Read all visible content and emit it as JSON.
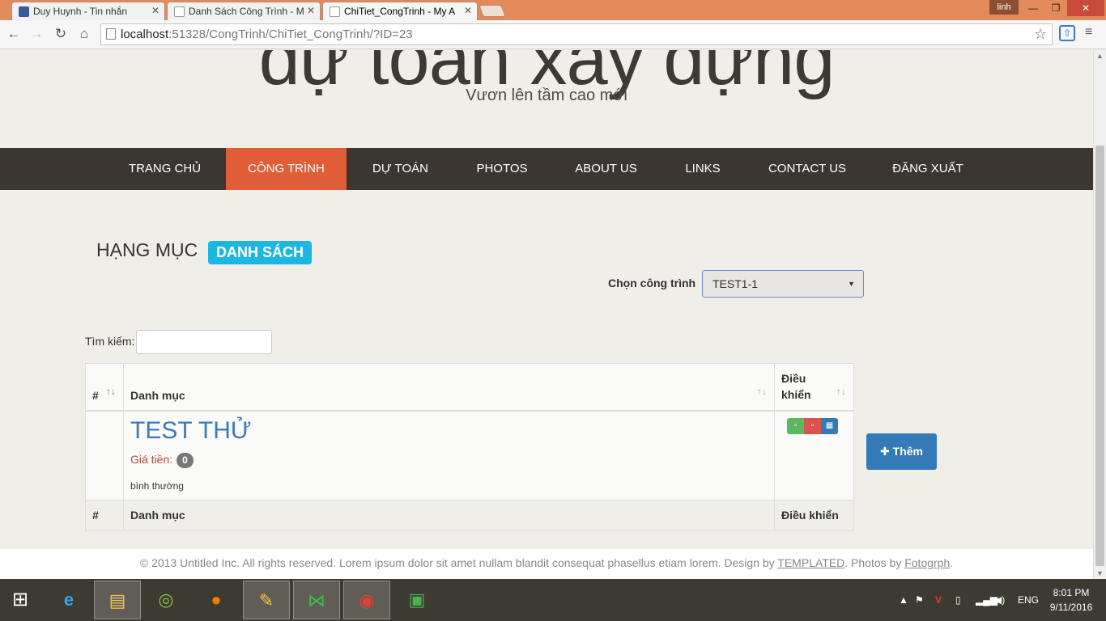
{
  "browser": {
    "tabs": [
      {
        "title": "Duy Huynh - Tin nhắn"
      },
      {
        "title": "Danh Sách Công Trình - M"
      },
      {
        "title": "ChiTiet_CongTrinh - My A"
      }
    ],
    "user": "linh",
    "url_host": "localhost",
    "url_path": ":51328/CongTrinh/ChiTiet_CongTrinh/?ID=23"
  },
  "header": {
    "site_title": "dự toán xây dựng",
    "tagline": "Vươn lên tầm cao mới"
  },
  "nav": {
    "items": [
      {
        "label": "TRANG CHỦ"
      },
      {
        "label": "CÔNG TRÌNH"
      },
      {
        "label": "DỰ TOÁN"
      },
      {
        "label": "PHOTOS"
      },
      {
        "label": "ABOUT US"
      },
      {
        "label": "LINKS"
      },
      {
        "label": "CONTACT US"
      },
      {
        "label": "ĐĂNG XUẤT"
      }
    ],
    "active": "CÔNG TRÌNH"
  },
  "main": {
    "title": "HẠNG MỤC",
    "badge": "DANH SÁCH",
    "select_label": "Chọn công trình",
    "select_value": "TEST1-1",
    "search_label": "Tìm kiếm:",
    "table": {
      "headers": [
        "#",
        "Danh mục",
        "Điều khiển"
      ],
      "header_dieu": "Điều",
      "header_khien": "khiển",
      "rows": [
        {
          "title": "TEST THỬ",
          "price_label": "Giá tiền:",
          "price": "0",
          "status": "bình thường"
        }
      ]
    },
    "add_button": "Thêm"
  },
  "footer": {
    "text_before": "© 2013 Untitled Inc. All rights reserved. Lorem ipsum dolor sit amet nullam blandit consequat phasellus etiam lorem. Design by ",
    "link1": "TEMPLATED",
    "text_mid": ". Photos by ",
    "link2": "Fotogrph",
    "text_end": "."
  },
  "taskbar": {
    "lang": "ENG",
    "time": "8:01 PM",
    "date": "9/11/2016"
  },
  "colors": {
    "nav_bg": "#3c3632",
    "nav_active": "#e15d38",
    "badge": "#1db6e1",
    "link": "#3b7abb",
    "primary": "#337ab7"
  }
}
